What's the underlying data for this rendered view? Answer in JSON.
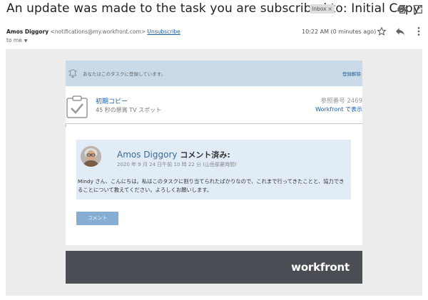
{
  "email": {
    "subject": "An update was made to the task you are subscribed to: Initial Copy",
    "label": "Inbox",
    "label_close": "×",
    "sender_name": "Amos Diggory",
    "sender_email": "<notifications@my.workfront.com>",
    "unsubscribe": "Unsubscribe",
    "recipient": "to me",
    "time": "10:22 AM (0 minutes ago)"
  },
  "icons": {
    "print": "print-icon",
    "open_new": "open-in-new-window-icon",
    "star": "star-icon",
    "reply": "reply-icon",
    "more": "more-vertical-icon",
    "bell": "bell-icon",
    "task": "task-checkbox-icon"
  },
  "banner": {
    "text": "あなたはこのタスクに登録しています。",
    "unsubscribe": "登録解除"
  },
  "task": {
    "title": "初期コピー",
    "subtitle": "45 秒の懸賞 TV スポット",
    "reference": "参照番号 2469",
    "view_link": "Workfront で表示"
  },
  "comment": {
    "author": "Amos Diggory",
    "action": "コメント済み:",
    "date": "2020 年 9 月 24 日午前 10 時 22 分 (山岳部夏時間)",
    "body": "Mindy さん、こんにちは。私はこのタスクに割り当てられたばかりなので、これまで行ってきたことと、協力できることについて教えてください。よろしくお願いします。",
    "button": "コメント"
  },
  "footer": {
    "logo": "workfront"
  },
  "colors": {
    "accent": "#1a5ea5",
    "banner_bg": "#c9dbe9",
    "comment_bg": "#e2ecf6",
    "button_bg": "#86aed2",
    "footer_bg": "#4a4d54"
  }
}
